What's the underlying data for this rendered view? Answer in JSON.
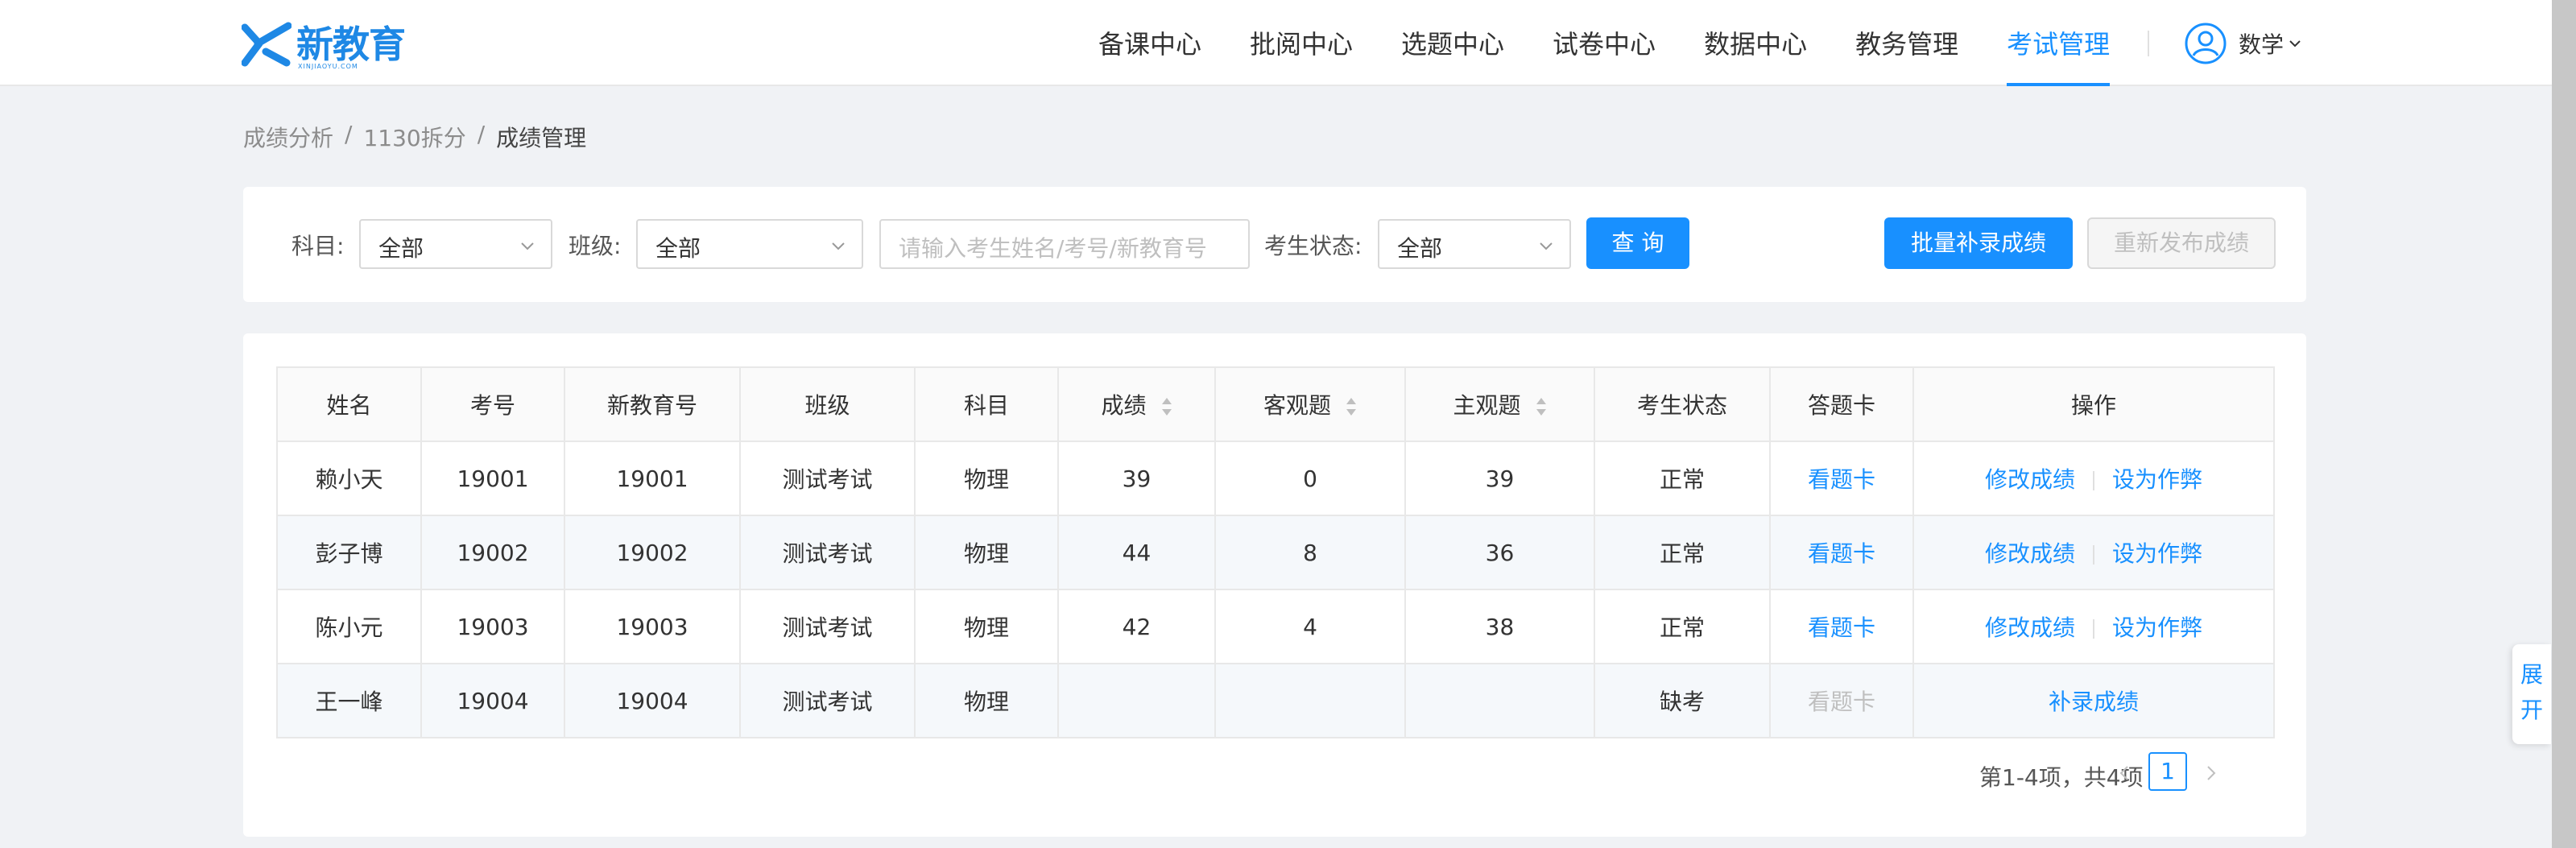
{
  "brand": {
    "name": "新教育",
    "sub": "XINJIAOYU.COM",
    "color": "#1e88e5"
  },
  "nav": {
    "items": [
      {
        "label": "备课中心"
      },
      {
        "label": "批阅中心"
      },
      {
        "label": "选题中心"
      },
      {
        "label": "试卷中心"
      },
      {
        "label": "数据中心"
      },
      {
        "label": "教务管理"
      },
      {
        "label": "考试管理",
        "active": true
      }
    ],
    "user": {
      "name": "数学",
      "icon": "user-avatar-icon"
    },
    "accent": "#1890ff"
  },
  "breadcrumb": [
    "成绩分析",
    "1130拆分",
    "成绩管理"
  ],
  "filters": {
    "subject_label": "科目:",
    "subject_value": "全部",
    "class_label": "班级:",
    "class_value": "全部",
    "search_placeholder": "请输入考生姓名/考号/新教育号",
    "status_label": "考生状态:",
    "status_value": "全部",
    "query_button": "查 询",
    "batch_button": "批量补录成绩",
    "republish_button": "重新发布成绩"
  },
  "table": {
    "columns": [
      "姓名",
      "考号",
      "新教育号",
      "班级",
      "科目",
      "成绩",
      "客观题",
      "主观题",
      "考生状态",
      "答题卡",
      "操作"
    ],
    "sortable": [
      "成绩",
      "客观题",
      "主观题"
    ],
    "rows": [
      {
        "name": "赖小天",
        "exam_no": "19001",
        "xjy_no": "19001",
        "class": "测试考试",
        "subject": "物理",
        "score": "39",
        "objective": "0",
        "subjective": "39",
        "status": "正常",
        "card": "看题卡",
        "card_enabled": true,
        "actions": [
          "修改成绩",
          "设为作弊"
        ]
      },
      {
        "name": "彭子博",
        "exam_no": "19002",
        "xjy_no": "19002",
        "class": "测试考试",
        "subject": "物理",
        "score": "44",
        "objective": "8",
        "subjective": "36",
        "status": "正常",
        "card": "看题卡",
        "card_enabled": true,
        "actions": [
          "修改成绩",
          "设为作弊"
        ]
      },
      {
        "name": "陈小元",
        "exam_no": "19003",
        "xjy_no": "19003",
        "class": "测试考试",
        "subject": "物理",
        "score": "42",
        "objective": "4",
        "subjective": "38",
        "status": "正常",
        "card": "看题卡",
        "card_enabled": true,
        "actions": [
          "修改成绩",
          "设为作弊"
        ]
      },
      {
        "name": "王一峰",
        "exam_no": "19004",
        "xjy_no": "19004",
        "class": "测试考试",
        "subject": "物理",
        "score": "",
        "objective": "",
        "subjective": "",
        "status": "缺考",
        "card": "看题卡",
        "card_enabled": false,
        "actions": [
          "补录成绩"
        ]
      }
    ]
  },
  "pagination": {
    "summary": "第1-4项，共4项",
    "current_page": "1"
  },
  "side_tab": {
    "label": "展开"
  }
}
